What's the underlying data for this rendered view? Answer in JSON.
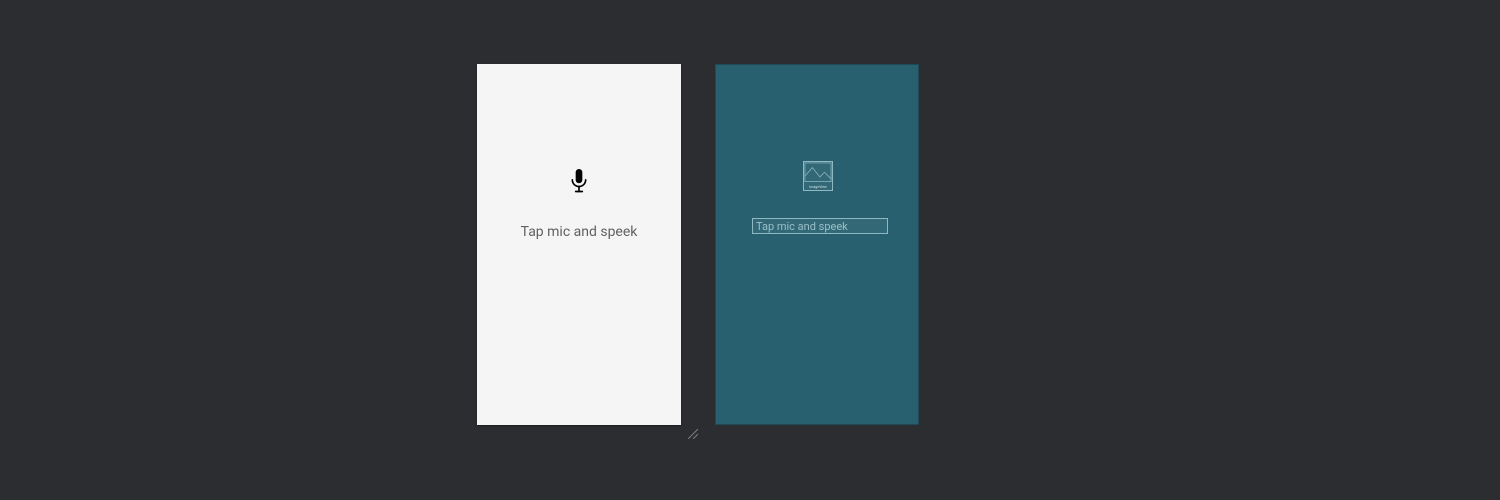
{
  "preview": {
    "hint_text": "Tap mic and speek"
  },
  "blueprint": {
    "image_label": "ImageView",
    "text_value": "Tap mic and speek"
  }
}
